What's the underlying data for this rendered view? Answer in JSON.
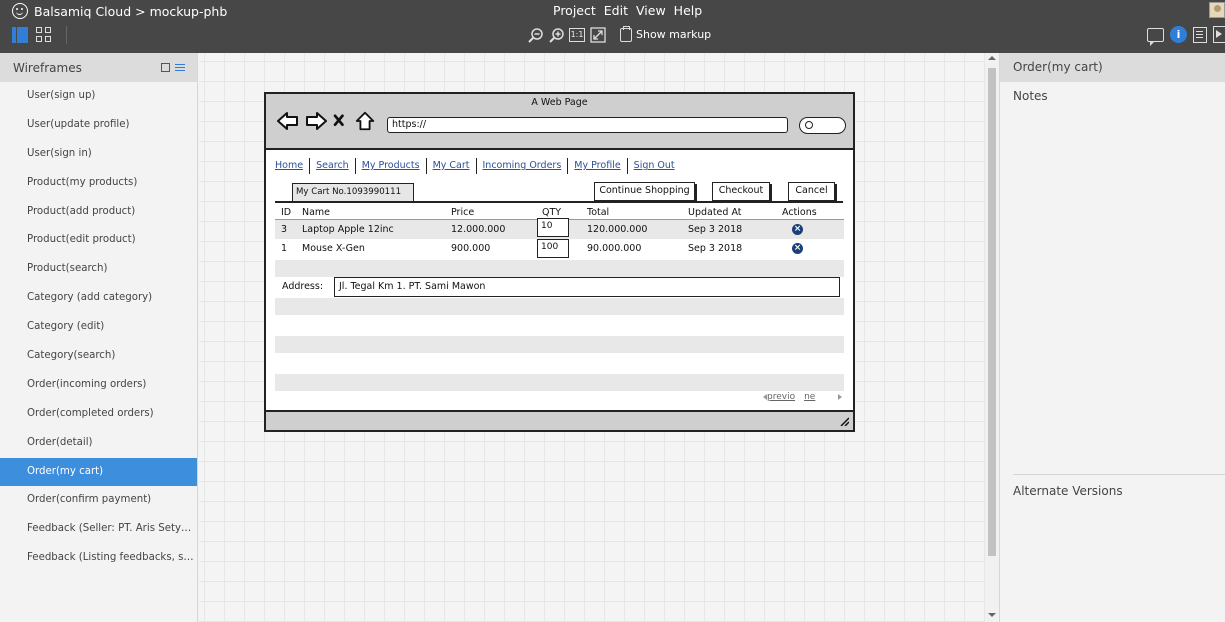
{
  "app": {
    "title": "Balsamiq Cloud > mockup-phb",
    "menu": [
      "Project",
      "Edit",
      "View",
      "Help"
    ],
    "toolbar": {
      "zoom_one_to_one": "1:1",
      "show_markup": "Show markup",
      "info_glyph": "i"
    }
  },
  "left_panel": {
    "title": "Wireframes",
    "items": [
      "User(sign up)",
      "User(update profile)",
      "User(sign in)",
      "Product(my products)",
      "Product(add product)",
      "Product(edit product)",
      "Product(search)",
      "Category (add category)",
      "Category (edit)",
      "Category(search)",
      "Order(incoming orders)",
      "Order(completed orders)",
      "Order(detail)",
      "Order(my cart)",
      "Order(confirm payment)",
      "Feedback (Seller: PT. Aris Setyawa...",
      "Feedback (Listing feedbacks, selle..."
    ],
    "selected_item": "Order(my cart)"
  },
  "mockup": {
    "window_title": "A Web Page",
    "url": "https://",
    "nav_links": [
      "Home",
      "Search",
      "My Products",
      "My Cart",
      "Incoming Orders",
      "My Profile",
      "Sign Out"
    ],
    "tab_label": "My Cart No.1093990111",
    "buttons": {
      "continue": "Continue Shopping",
      "checkout": "Checkout",
      "cancel": "Cancel"
    },
    "table": {
      "columns": [
        "ID",
        "Name",
        "Price",
        "QTY",
        "Total",
        "Updated At",
        "Actions"
      ],
      "rows": [
        {
          "id": "3",
          "name": "Laptop Apple 12inc",
          "price": "12.000.000",
          "qty": "10",
          "total": "120.000.000",
          "updated": "Sep 3 2018",
          "action_glyph": "×"
        },
        {
          "id": "1",
          "name": "Mouse X-Gen",
          "price": "900.000",
          "qty": "100",
          "total": "90.000.000",
          "updated": "Sep 3 2018",
          "action_glyph": "×"
        }
      ]
    },
    "address": {
      "label": "Address:",
      "value": "Jl. Tegal Km 1. PT. Sami Mawon"
    },
    "pager": {
      "prev": "previo",
      "next": "ne"
    }
  },
  "right_panel": {
    "title": "Order(my cart)",
    "notes_label": "Notes",
    "alternate_versions_label": "Alternate Versions"
  },
  "colors": {
    "topbar": "#474747",
    "accent": "#3e8ede",
    "link": "#2a4f9a"
  }
}
